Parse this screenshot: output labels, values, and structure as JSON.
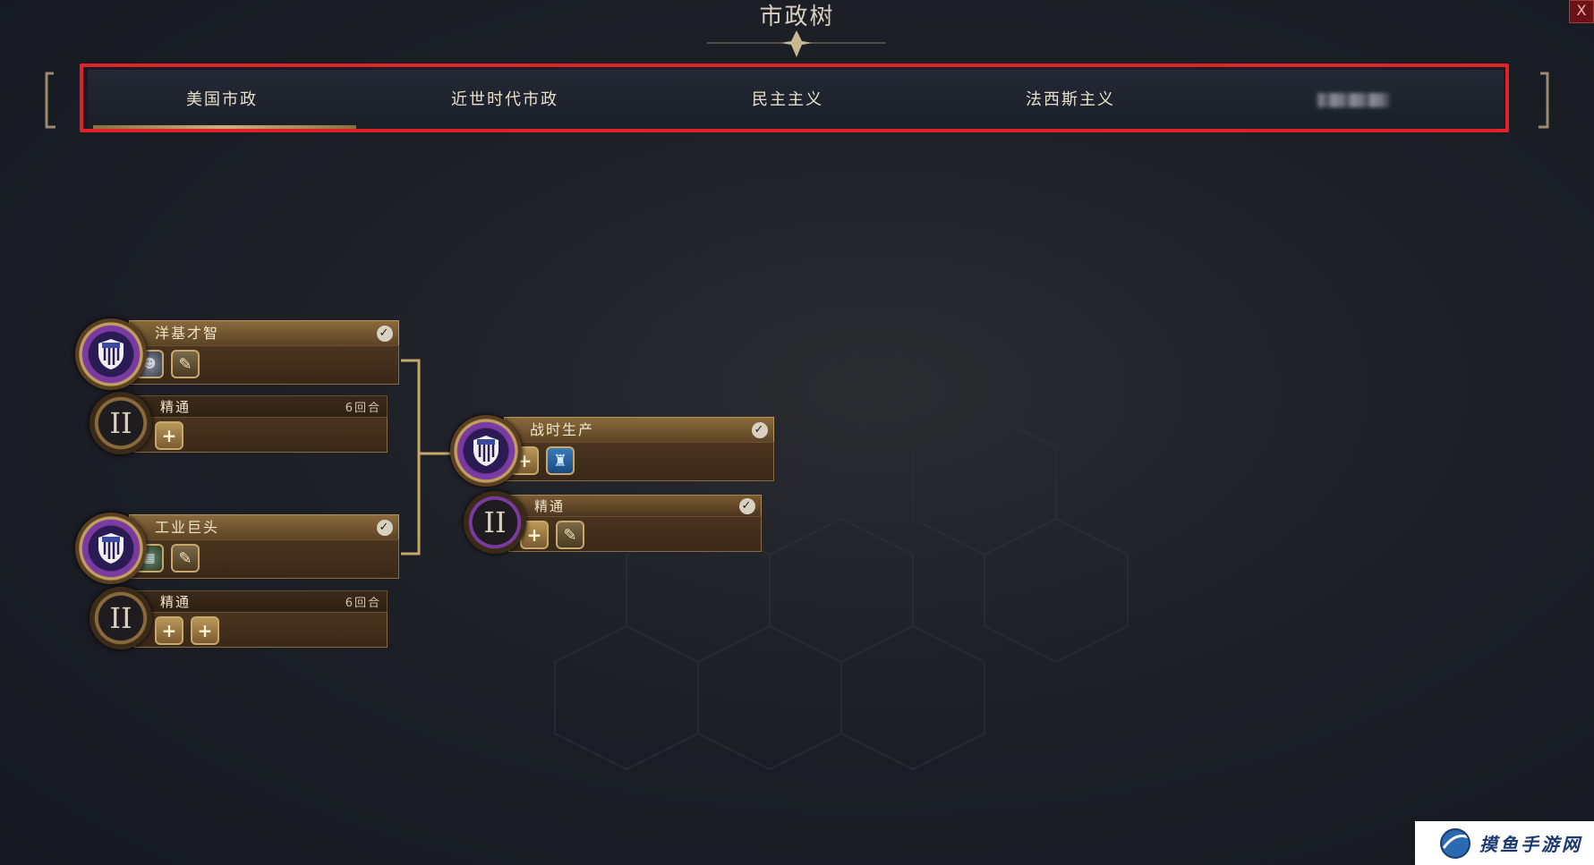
{
  "window": {
    "title": "市政树",
    "close_label": "X"
  },
  "tabs": [
    {
      "label": "美国市政",
      "active": true
    },
    {
      "label": "近世时代市政",
      "active": false
    },
    {
      "label": "民主主义",
      "active": false
    },
    {
      "label": "法西斯主义",
      "active": false
    },
    {
      "label": "",
      "active": false,
      "blurred": true
    }
  ],
  "civics": [
    {
      "name": "洋基才智",
      "completed": true,
      "unlocks": [
        "unit-portrait",
        "quill-icon"
      ],
      "mastery": {
        "label": "精通",
        "turns": "6回合",
        "unlocks": [
          "plus-icon"
        ]
      }
    },
    {
      "name": "工业巨头",
      "completed": true,
      "unlocks": [
        "factory-portrait",
        "quill-icon"
      ],
      "mastery": {
        "label": "精通",
        "turns": "6回合",
        "unlocks": [
          "plus-icon",
          "plus-icon"
        ]
      }
    },
    {
      "name": "战时生产",
      "completed": true,
      "unlocks": [
        "plus-icon",
        "statue-icon"
      ],
      "mastery": {
        "label": "精通",
        "completed": true,
        "roman": "II",
        "unlocks": [
          "plus-icon",
          "quill-icon"
        ]
      }
    }
  ],
  "mastery_roman": "II",
  "watermark": {
    "text": "摸鱼手游网"
  },
  "colors": {
    "highlight": "#e0222a",
    "accent_gold": "#c0a060",
    "badge_purple": "#7a3aa0"
  }
}
